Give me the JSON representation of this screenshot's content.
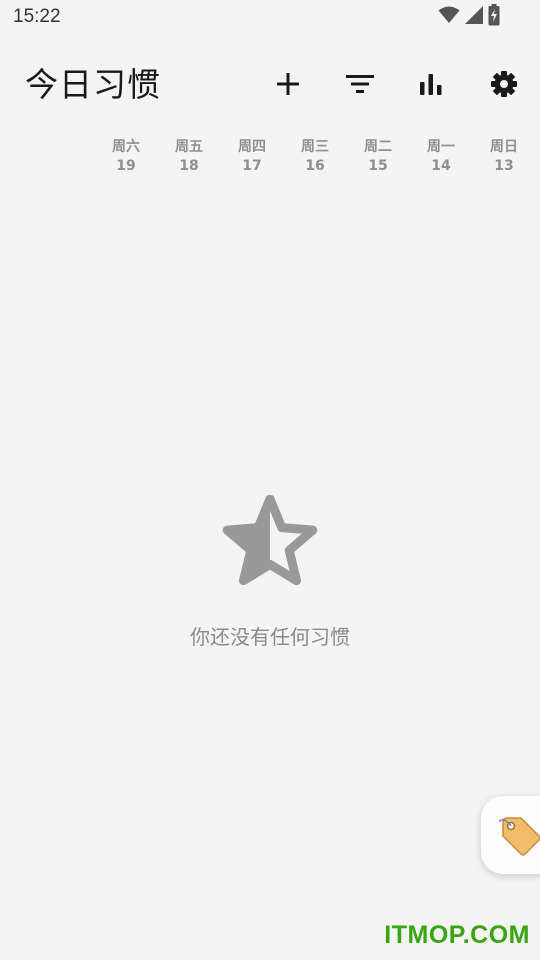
{
  "status_bar": {
    "time": "15:22",
    "icons": [
      "wifi-icon",
      "signal-icon",
      "battery-charging-icon"
    ]
  },
  "app_bar": {
    "title": "今日习惯",
    "actions": [
      "add-icon",
      "filter-icon",
      "stats-icon",
      "settings-icon"
    ]
  },
  "day_headers": [
    {
      "weekday": "周六",
      "date": "19"
    },
    {
      "weekday": "周五",
      "date": "18"
    },
    {
      "weekday": "周四",
      "date": "17"
    },
    {
      "weekday": "周三",
      "date": "16"
    },
    {
      "weekday": "周二",
      "date": "15"
    },
    {
      "weekday": "周一",
      "date": "14"
    },
    {
      "weekday": "周日",
      "date": "13"
    }
  ],
  "empty_state": {
    "icon": "star-half-icon",
    "message": "你还没有任何习惯"
  },
  "floating_button": {
    "icon": "tag-icon"
  },
  "watermark": "ITMOP.COM",
  "colors": {
    "background": "#f4f4f4",
    "icon_dark": "#1a1a1a",
    "muted_text": "#8f8f8f",
    "star": "#999999",
    "watermark": "#3aa510"
  }
}
